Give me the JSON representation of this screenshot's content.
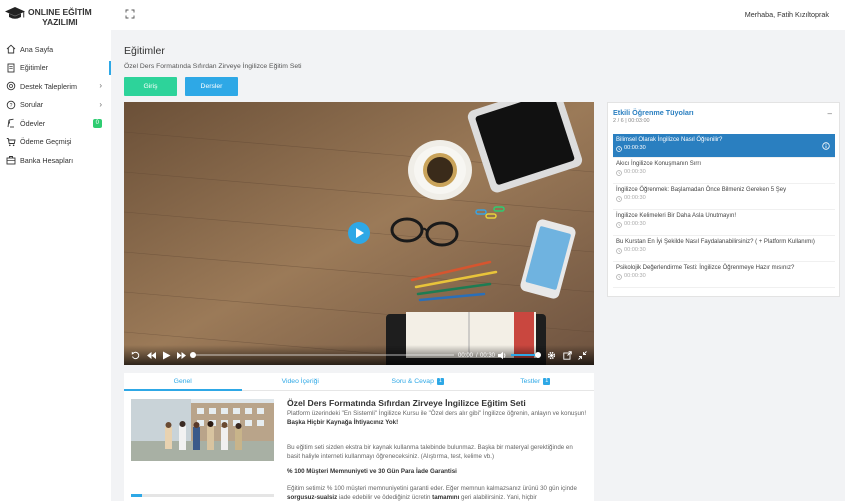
{
  "app": {
    "logo_line1": "ONLINE EĞİTİM",
    "logo_line2": "YAZILIMI",
    "greeting": "Merhaba, Fatih Kızıltoprak"
  },
  "sidebar": {
    "items": [
      {
        "label": "Ana Sayfa",
        "icon": "home-icon"
      },
      {
        "label": "Eğitimler",
        "icon": "document-icon",
        "active": true
      },
      {
        "label": "Destek Taleplerim",
        "icon": "support-icon"
      },
      {
        "label": "Sorular",
        "icon": "question-icon"
      },
      {
        "label": "Ödevler",
        "icon": "assignment-icon",
        "badge": "0"
      },
      {
        "label": "Ödeme Geçmişi",
        "icon": "cart-icon"
      },
      {
        "label": "Banka Hesapları",
        "icon": "bank-icon"
      }
    ]
  },
  "page": {
    "title": "Eğitimler",
    "subtitle": "Özel Ders Formatında Sıfırdan Zirveye İngilizce Eğitim Seti",
    "btn_giris": "Giriş",
    "btn_dersler": "Dersler"
  },
  "player": {
    "current": "00:00",
    "duration": "00:30",
    "progress": 0,
    "volume": 1.0
  },
  "tabs": [
    {
      "label": "Genel",
      "active": true
    },
    {
      "label": "Video İçeriği"
    },
    {
      "label": "Soru & Cevap",
      "badge": "1"
    },
    {
      "label": "Testler",
      "badge": "1"
    }
  ],
  "course": {
    "title": "Özel Ders Formatında Sıfırdan Zirveye İngilizce Eğitim Seti",
    "p1": "Platform üzerindeki \"En Sistemli\" İngilizce Kursu ile \"Özel ders alır gibi\" İngilizce öğrenin, anlayın ve konuşun!",
    "p1_bold": "Başka Hiçbir Kaynağa İhtiyacınız Yok!",
    "p2": "Bu eğitim seti sizden ekstra bir kaynak kullanma talebinde bulunmaz. Başka bir materyal gerektiğinde en basit haliyle interneti kullanmayı öğreneceksiniz. (Alıştırma, test, kelime vb.)",
    "p3_bold": "% 100 Müşteri Memnuniyeti ve 30 Gün Para İade Garantisi",
    "p4a": "Eğitim setimiz % 100 müşteri memnuniyetini garanti eder. Eğer memnun kalmazsanız ürünü 30 gün içinde ",
    "p4b": "sorgusuz-sualsiz",
    "p4c": " iade edebilir ve ödediğiniz ücretin ",
    "p4d": "tamamını",
    "p4e": " geri alabilirsiniz. Yani, hiçbir",
    "thumb_progress": 0.08
  },
  "tips": {
    "title": "Etkili Öğrenme Tüyoları",
    "meta": "2 / 6 | 00:03:00",
    "items": [
      {
        "title": "Bilimsel Olarak İngilizce Nasıl Öğrenilir?",
        "time": "00:00:30",
        "active": true
      },
      {
        "title": "Akıcı İngilizce Konuşmanın Sırrı",
        "time": "00:00:30"
      },
      {
        "title": "İngilizce Öğrenmek: Başlamadan Önce Bilmeniz Gereken 5 Şey",
        "time": "00:00:30"
      },
      {
        "title": "İngilizce Kelimeleri Bir Daha Asla Unutmayın!",
        "time": "00:00:30"
      },
      {
        "title": "Bu Kurstan En İyi Şekilde Nasıl Faydalanabilirsiniz? ( + Platform Kullanımı)",
        "time": "00:00:30"
      },
      {
        "title": "Psikolojik Değerlendirme Testi: İngilizce Öğrenmeye Hazır mısınız?",
        "time": "00:00:30"
      }
    ]
  },
  "colors": {
    "accent": "#2ea8e6",
    "green": "#2dd39a",
    "active_tip": "#2a7fc0"
  }
}
